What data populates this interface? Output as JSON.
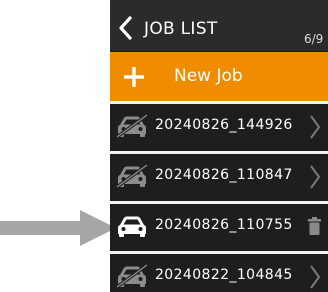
{
  "header": {
    "title": "JOB LIST",
    "page_indicator": "6/9",
    "back_icon": "chevron-left-icon"
  },
  "new_job": {
    "label": "New Job",
    "icon": "plus-icon"
  },
  "jobs": [
    {
      "name": "20240826_144926",
      "selected": false,
      "icon": "car-icon",
      "action_icon": "chevron-right-icon"
    },
    {
      "name": "20240826_110847",
      "selected": false,
      "icon": "car-icon",
      "action_icon": "chevron-right-icon"
    },
    {
      "name": "20240826_110755",
      "selected": true,
      "icon": "car-icon",
      "action_icon": "trash-icon"
    },
    {
      "name": "20240822_104845",
      "selected": false,
      "icon": "car-icon",
      "action_icon": "chevron-right-icon"
    }
  ],
  "colors": {
    "accent": "#f08c00",
    "background": "#1e1e1e",
    "title_bar": "#2b2b2b",
    "pointer_arrow": "#a6a6a6"
  }
}
